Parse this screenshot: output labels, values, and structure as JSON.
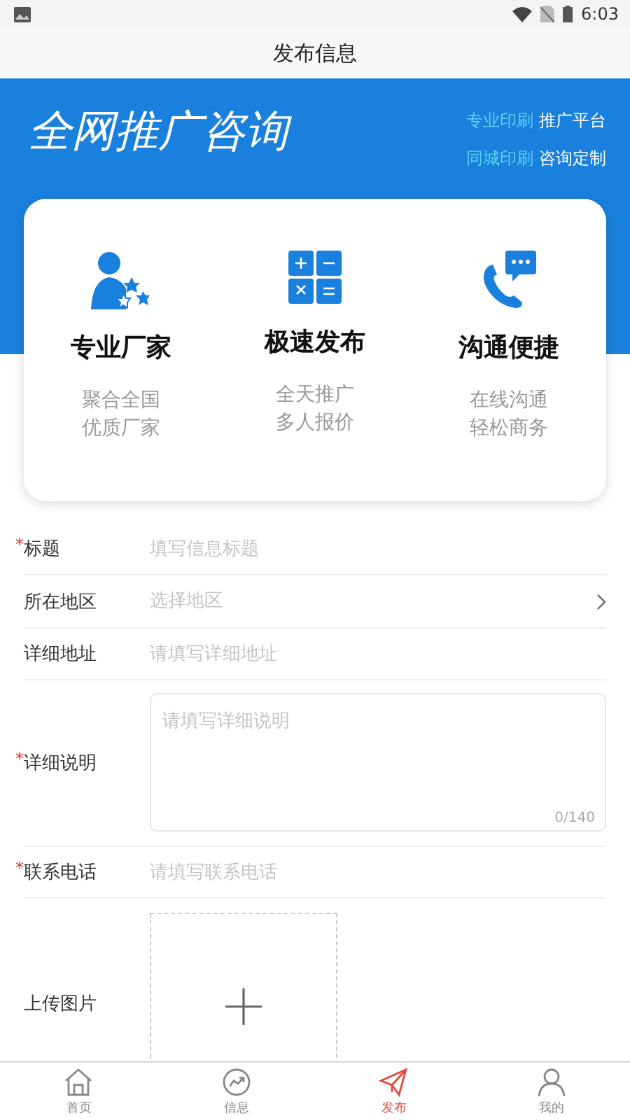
{
  "status_bar": {
    "time": "6:03"
  },
  "header": {
    "title": "发布信息"
  },
  "banner": {
    "title": "全网推广咨询",
    "lines": [
      {
        "highlight": "专业印刷",
        "text": "推广平台"
      },
      {
        "highlight": "同城印刷",
        "text": "咨询定制"
      }
    ]
  },
  "features": [
    {
      "kind": "person",
      "title": "专业厂家",
      "lines": [
        "聚合全国",
        "优质厂家"
      ]
    },
    {
      "kind": "calculator",
      "title": "极速发布",
      "lines": [
        "全天推广",
        "多人报价"
      ]
    },
    {
      "kind": "phone",
      "title": "沟通便捷",
      "lines": [
        "在线沟通",
        "轻松商务"
      ]
    }
  ],
  "required_mark": "*",
  "form": [
    {
      "kind": "input",
      "label": "标题",
      "required": true,
      "placeholder": "填写信息标题"
    },
    {
      "kind": "select",
      "label": "所在地区",
      "required": false,
      "placeholder": "选择地区"
    },
    {
      "kind": "input",
      "label": "详细地址",
      "required": false,
      "placeholder": "请填写详细地址"
    },
    {
      "kind": "textarea",
      "label": "详细说明",
      "required": true,
      "placeholder": "请填写详细说明",
      "counter": "0/140"
    },
    {
      "kind": "input",
      "label": "联系电话",
      "required": true,
      "placeholder": "请填写联系电话"
    },
    {
      "kind": "upload",
      "label": "上传图片",
      "required": false
    }
  ],
  "tab_bar": [
    {
      "kind": "home",
      "label": "首页",
      "selected": false
    },
    {
      "kind": "trend",
      "label": "信息",
      "selected": false
    },
    {
      "kind": "send",
      "label": "发布",
      "selected": true
    },
    {
      "kind": "user",
      "label": "我的",
      "selected": false
    }
  ]
}
